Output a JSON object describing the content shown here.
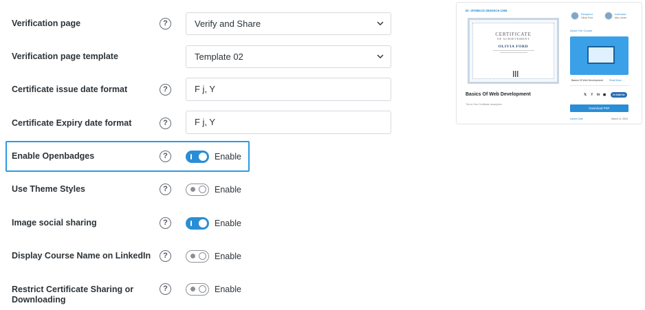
{
  "settings": {
    "verification_page": {
      "label": "Verification page",
      "value": "Verify and Share"
    },
    "verification_template": {
      "label": "Verification page template",
      "value": "Template 02"
    },
    "issue_date_format": {
      "label": "Certificate issue date format",
      "value": "F j, Y"
    },
    "expiry_date_format": {
      "label": "Certificate Expiry date format",
      "value": "F j, Y"
    },
    "enable_openbadges": {
      "label": "Enable Openbadges",
      "state": "on",
      "toggle_text": "Enable"
    },
    "use_theme_styles": {
      "label": "Use Theme Styles",
      "state": "off",
      "toggle_text": "Enable"
    },
    "image_social_sharing": {
      "label": "Image social sharing",
      "state": "on",
      "toggle_text": "Enable"
    },
    "display_course_linkedin": {
      "label": "Display Course Name on LinkedIn",
      "state": "off",
      "toggle_text": "Enable"
    },
    "restrict_sharing": {
      "label_line1": "Restrict Certificate Sharing or",
      "label_line2": "Downloading",
      "state": "off",
      "toggle_text": "Enable"
    }
  },
  "help_icon_glyph": "?",
  "preview": {
    "cert_id": "ID: 2FD8ECD-2B3D0C6-1368",
    "certificate_title": "CERTIFICATE",
    "certificate_subtitle": "OF ACHIEVEMENT",
    "recipient_name": "OLIVIA FORD",
    "course_title": "Basics Of Web Development",
    "course_desc": "This is Free Certificate description",
    "recipient_role": "Recipient",
    "recipient_person": "Olivia Ford",
    "instructor_role": "Instructor",
    "instructor_person": "Alex Jones",
    "about_label": "About The Course",
    "course_image_title": "Basics Of Web Development",
    "course_image_link": "Read More →",
    "share_icons": [
      "𝕏",
      "f",
      "in",
      "◼"
    ],
    "linkedin_label": "in Add to",
    "download_label": "Download PDF",
    "footer_left": "Issued Date",
    "footer_right": "March 11, 2024"
  },
  "colors": {
    "accent": "#2a8ed6",
    "highlight_border": "#2a9be0",
    "toggle_off": "#8c8f94"
  }
}
